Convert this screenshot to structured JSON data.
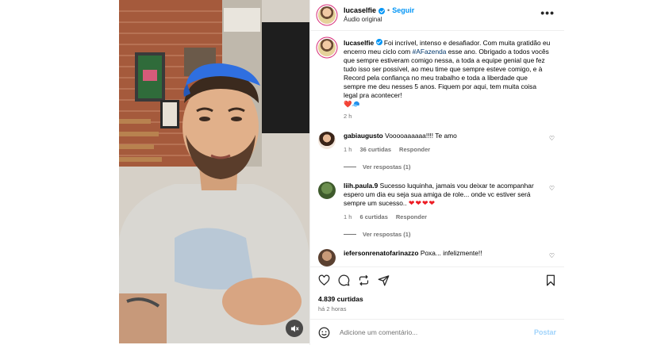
{
  "header": {
    "username": "lucaselfie",
    "separator": "•",
    "follow_label": "Seguir",
    "audio_label": "Áudio original",
    "more_label": "•••"
  },
  "caption": {
    "username": "lucaselfie",
    "text_before": "Foi incrível, intenso e desafiador. Com muita gratidão eu encerro meu ciclo com ",
    "hashtag": "#AFazenda",
    "text_after": " esse ano. Obrigado a todos vocês que sempre estiveram comigo nessa, a toda a equipe genial que fez tudo isso ser possível, ao meu time que sempre esteve comigo, e à Record pela confiança no meu trabalho e toda a liberdade que sempre me deu nesses 5 anos. Fiquem por aqui, tem muita coisa legal pra acontecer!",
    "emojis": "❤️🧢",
    "time": "2 h"
  },
  "comments": [
    {
      "username": "gabiaugusto",
      "text": "Vooooaaaaaa!!!! Te amo",
      "time": "1 h",
      "likes": "36 curtidas",
      "reply_label": "Responder",
      "view_replies": "Ver respostas (1)"
    },
    {
      "username": "liih.paula.9",
      "text": "Sucesso luquinha, jamais vou deixar te acompanhar espero um dia eu seja sua amiga de role... onde vc estiver será sempre um sucesso.. ",
      "hearts": "❤❤❤❤",
      "time": "1 h",
      "likes": "6 curtidas",
      "reply_label": "Responder",
      "view_replies": "Ver respostas (1)"
    },
    {
      "username": "iefersonrenatofarinazzo",
      "text": "Poxa... infelizmente!!"
    }
  ],
  "actions": {
    "likes": "4.839 curtidas",
    "time": "há 2 horas"
  },
  "add_comment": {
    "placeholder": "Adicione um comentário...",
    "post_label": "Postar"
  },
  "icons": {
    "like": "heart-icon",
    "comment": "comment-icon",
    "share": "repost-icon",
    "send": "send-icon",
    "save": "bookmark-icon",
    "emoji": "emoji-icon",
    "mute": "speaker-muted-icon"
  },
  "colors": {
    "accent": "#0095f6",
    "link": "#00376b",
    "muted": "#737373",
    "post_disabled": "#9fd3fb"
  }
}
